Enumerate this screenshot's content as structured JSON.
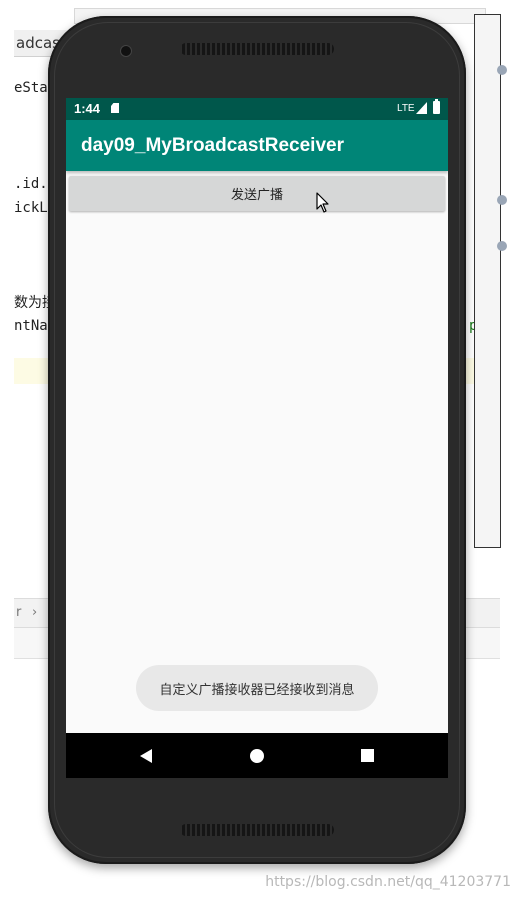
{
  "ide": {
    "tab_label": "adcast",
    "code_lines": [
      "eStat",
      ".id.a",
      "ickLi",
      "数为接",
      "ntNam"
    ],
    "breadcrumb_arrow": "›",
    "breadcrumb_left": "r"
  },
  "watermark": "https://blog.csdn.net/qq_41203771",
  "device": {
    "status_bar": {
      "time": "1:44",
      "network": "LTE"
    },
    "app_bar": {
      "title": "day09_MyBroadcastReceiver"
    },
    "main": {
      "send_button_label": "发送广播"
    },
    "toast": {
      "message": "自定义广播接收器已经接收到消息"
    }
  },
  "colors": {
    "status_bar": "#00574b",
    "app_bar": "#008577",
    "button": "#d6d7d7",
    "toast": "#e8e8e8"
  }
}
